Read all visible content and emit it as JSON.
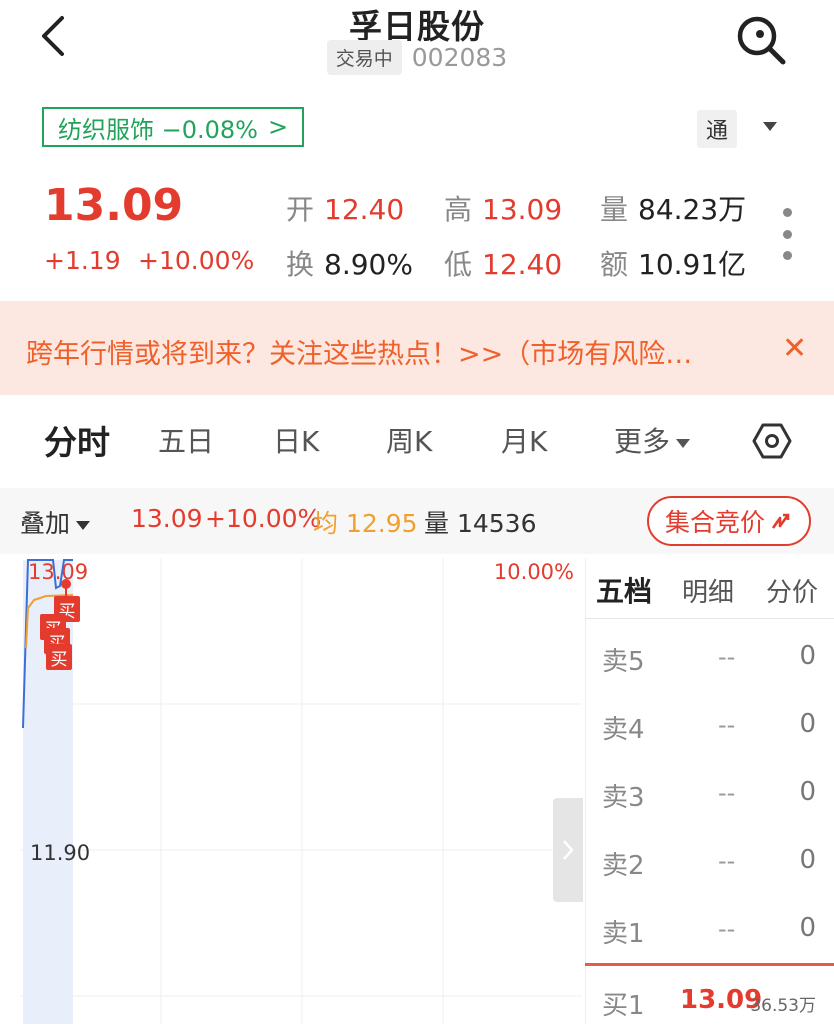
{
  "header": {
    "title": "孚日股份",
    "status": "交易中",
    "code": "002083"
  },
  "sector": {
    "label": "纺织服饰 −0.08%",
    "arrow": ">"
  },
  "tong_label": "通",
  "quote": {
    "price": "13.09",
    "change_amount": "+1.19",
    "change_percent": "+10.00%",
    "open_label": "开",
    "open": "12.40",
    "high_label": "高",
    "high": "13.09",
    "volume_label": "量",
    "volume": "84.23万",
    "turnover_label": "换",
    "turnover": "8.90%",
    "low_label": "低",
    "low": "12.40",
    "amount_label": "额",
    "amount": "10.91亿"
  },
  "banner": {
    "text": "跨年行情或将到来？关注这些热点！>>（市场有风险…",
    "close": "✕"
  },
  "tabs": [
    {
      "label": "分时"
    },
    {
      "label": "五日"
    },
    {
      "label": "日K"
    },
    {
      "label": "周K"
    },
    {
      "label": "月K"
    },
    {
      "label": "更多"
    }
  ],
  "overlay": {
    "label": "叠加",
    "price": "13.09",
    "pct": "+10.00%",
    "avg_label": "均",
    "avg": "12.95",
    "vol_label": "量",
    "vol": "14536",
    "auction_label": "集合竞价"
  },
  "chart": {
    "top_price": "13.09",
    "top_pct": "10.00%",
    "mid_price": "11.90",
    "buy_tag": "买"
  },
  "order_book": {
    "tabs": [
      "五档",
      "明细",
      "分价"
    ],
    "asks": [
      {
        "label": "卖5",
        "price": "--",
        "volume": "0"
      },
      {
        "label": "卖4",
        "price": "--",
        "volume": "0"
      },
      {
        "label": "卖3",
        "price": "--",
        "volume": "0"
      },
      {
        "label": "卖2",
        "price": "--",
        "volume": "0"
      },
      {
        "label": "卖1",
        "price": "--",
        "volume": "0"
      }
    ],
    "bid1": {
      "label": "买1",
      "price": "13.09",
      "volume": "36.53万"
    }
  },
  "colors": {
    "up_red": "#e33b2e",
    "sector_green": "#22a35a",
    "banner_bg": "#fde8e1",
    "banner_text": "#f0602a",
    "price_line": "#3a6fd8",
    "avg_line": "#f0a030"
  }
}
